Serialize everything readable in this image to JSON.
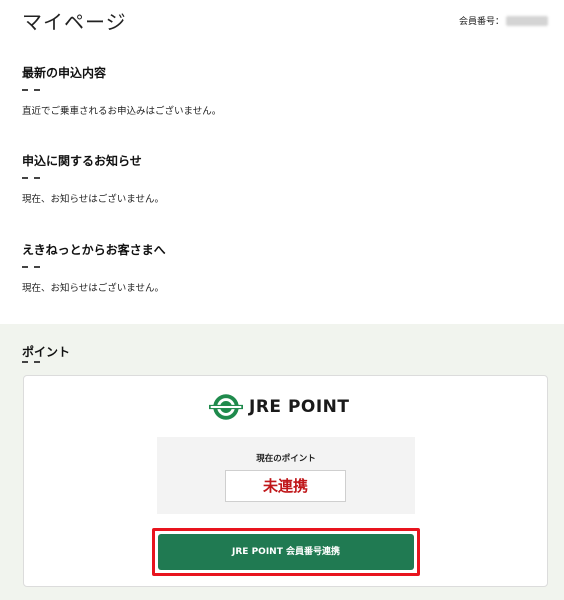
{
  "header": {
    "title": "マイページ",
    "member_label": "会員番号："
  },
  "sections": [
    {
      "heading": "最新の申込内容",
      "body": "直近でご乗車されるお申込みはございません。"
    },
    {
      "heading": "申込に関するお知らせ",
      "body": "現在、お知らせはございません。"
    },
    {
      "heading": "えきねっとからお客さまへ",
      "body": "現在、お知らせはございません。"
    }
  ],
  "points": {
    "heading": "ポイント",
    "logo_text": "JRE POINT",
    "current_label": "現在のポイント",
    "current_value": "未連携",
    "link_button": "JRE POINT 会員番号連携"
  },
  "colors": {
    "button_green": "#207a52",
    "highlight_red": "#e8141e",
    "value_red": "#c0171a",
    "band_bg": "#f1f4ee"
  },
  "icons": {
    "logo": "jre-point-logo-icon"
  }
}
